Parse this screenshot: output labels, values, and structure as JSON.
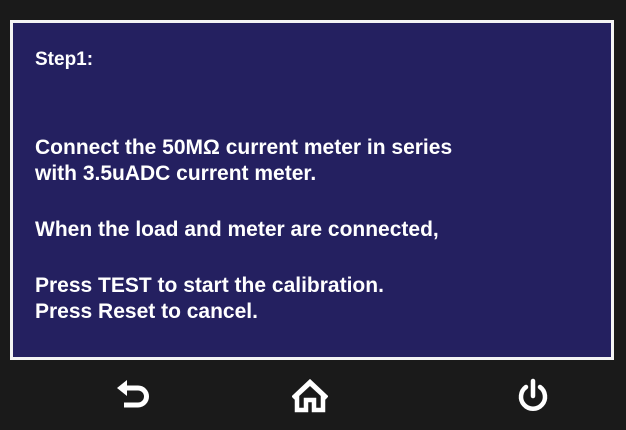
{
  "instructions": {
    "step_label": "Step1:",
    "line1": "Connect the 50MΩ current meter in series",
    "line2": "with 3.5uADC current meter.",
    "line3": "When the load and meter are connected,",
    "line4": "Press TEST to start the calibration.",
    "line5": "Press Reset to cancel."
  },
  "toolbar": {
    "back_icon": "back-arrow-icon",
    "home_icon": "home-icon",
    "power_icon": "power-icon"
  },
  "colors": {
    "panel_background": "#242060",
    "panel_border": "#f4f4f4",
    "toolbar_background": "#1a1a1a",
    "text": "#ffffff"
  }
}
